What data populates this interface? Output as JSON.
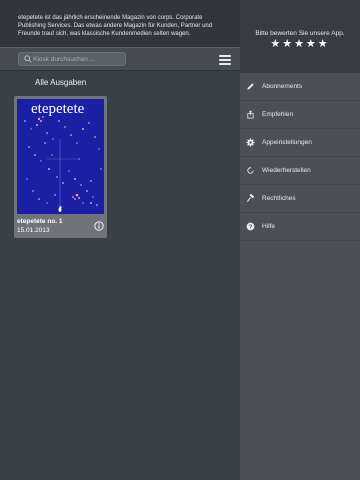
{
  "intro": {
    "text": "etepetete ist das jährlich erscheinende Magazin von corps. Corporate Publishing Services. Das etwas andere Magazin für Kunden, Partner und Freunde traut sich, was klassische Kundenmedien selten wagen."
  },
  "search": {
    "placeholder": "Kiosk durchsuchen ..."
  },
  "section_title": "Alle Ausgaben",
  "issue": {
    "cover_title": "etepetete",
    "name": "etepetete no. 1",
    "date": "15.01.2013"
  },
  "rating": {
    "prompt": "Bitte bewerten Sie unsere App.",
    "stars": "★★★★★"
  },
  "menu": {
    "items": [
      {
        "label": "Abonnements",
        "icon": "pencil-icon"
      },
      {
        "label": "Empfehlen",
        "icon": "share-icon"
      },
      {
        "label": "Appeinstellungen",
        "icon": "gear-icon"
      },
      {
        "label": "Wiederherstellen",
        "icon": "restore-icon"
      },
      {
        "label": "Rechtliches",
        "icon": "hammer-icon"
      },
      {
        "label": "Hilfe",
        "icon": "help-icon"
      }
    ]
  },
  "colors": {
    "panel_dark": "#384048",
    "panel_right": "#4a5057",
    "cover_blue": "#1a1f9e"
  }
}
